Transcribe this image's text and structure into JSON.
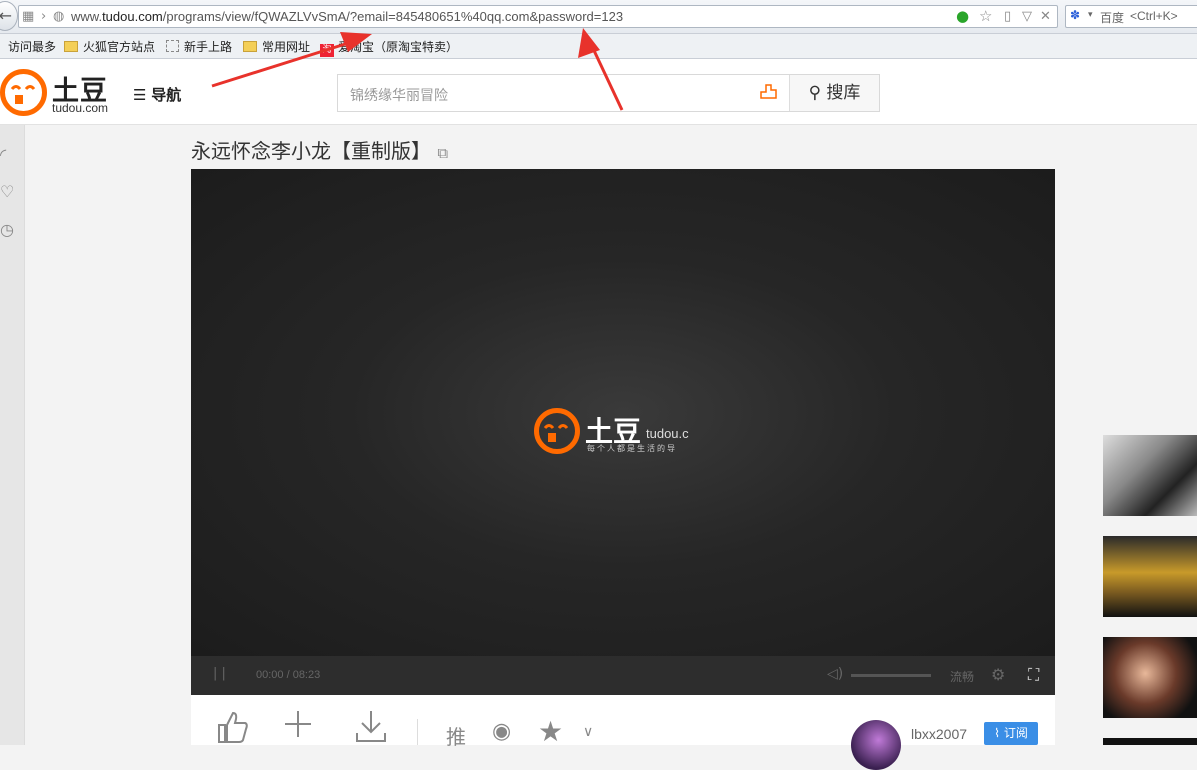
{
  "browser": {
    "url": {
      "prefix": "www.",
      "domain": "tudou.com",
      "rest": "/programs/view/fQWAZLVvSmA/?email=845480651%40qq.com&password=123"
    },
    "search": {
      "engine": "百度",
      "shortcut": "<Ctrl+K>"
    },
    "bookmarks": [
      "访问最多",
      "火狐官方站点",
      "新手上路",
      "常用网址",
      "爱淘宝（原淘宝特卖）"
    ],
    "taobao_badge": "淘"
  },
  "site": {
    "logo_cn": "土豆",
    "logo_en": "tudou.com",
    "nav_label": "导航",
    "search_placeholder": "锦绣缘华丽冒险",
    "search_button": "搜库"
  },
  "video": {
    "title": "永远怀念李小龙【重制版】",
    "player_logo_cn": "土豆",
    "player_logo_en": "tudou.c",
    "player_slogan": "每个人都是生活的导",
    "time": "00:00 / 08:23",
    "quality": "流畅"
  },
  "actions": {
    "share_label": "推",
    "uploader": "lbxx2007",
    "subscribe": "订阅"
  },
  "icons": {
    "like": "thumbs-up-icon",
    "add": "plus-icon",
    "download": "download-icon",
    "weibo": "weibo-icon",
    "favorite": "star-icon"
  },
  "colors": {
    "brand": "#ff6a00",
    "subscribe": "#3a8ee6",
    "annotation": "#e8322b"
  }
}
